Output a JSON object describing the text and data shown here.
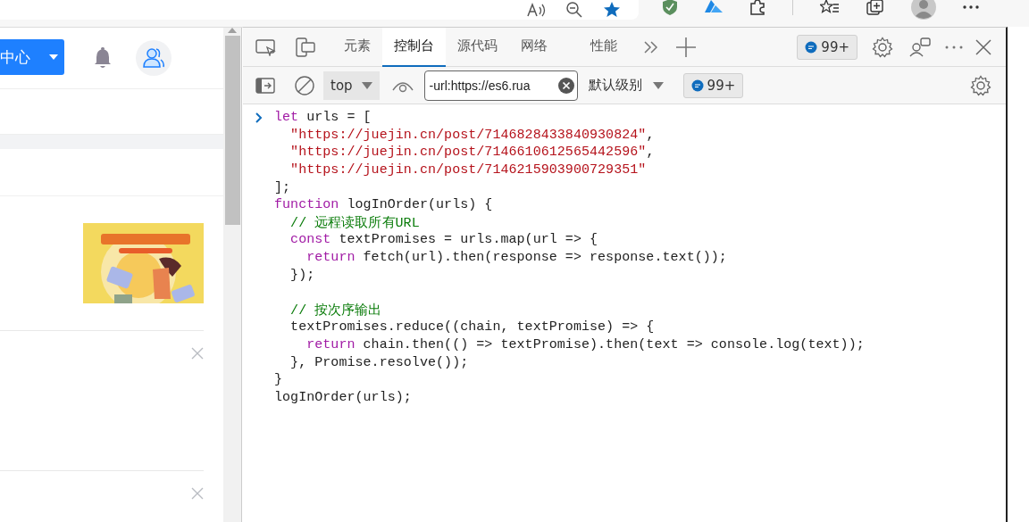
{
  "page": {
    "header_button": "中心"
  },
  "devtools": {
    "tabs": [
      {
        "label": "元素",
        "selected": false
      },
      {
        "label": "控制台",
        "selected": true
      },
      {
        "label": "源代码",
        "selected": false
      },
      {
        "label": "网络",
        "selected": false
      },
      {
        "label": "性能",
        "selected": false
      }
    ],
    "issues_badge": "99+",
    "context_select": "top",
    "filter": {
      "value": "-url:https://es6.rua"
    },
    "level_select": "默认级别",
    "filter_badge": "99+"
  },
  "console": {
    "blocks": [
      {
        "lines": [
          {
            "prompt": true,
            "segments": [
              {
                "kind": "keyword",
                "text": "let"
              },
              {
                "kind": "plain",
                "text": " urls = ["
              }
            ]
          },
          {
            "prompt": false,
            "segments": [
              {
                "kind": "string",
                "text": "  \"https://juejin.cn/post/7146828433840930824\""
              },
              {
                "kind": "plain",
                "text": ","
              }
            ]
          },
          {
            "prompt": false,
            "segments": [
              {
                "kind": "string",
                "text": "  \"https://juejin.cn/post/7146610612565442596\""
              },
              {
                "kind": "plain",
                "text": ","
              }
            ]
          },
          {
            "prompt": false,
            "segments": [
              {
                "kind": "string",
                "text": "  \"https://juejin.cn/post/7146215903900729351\""
              }
            ]
          },
          {
            "prompt": false,
            "segments": [
              {
                "kind": "plain",
                "text": "];"
              }
            ]
          },
          {
            "prompt": false,
            "segments": [
              {
                "kind": "keyword",
                "text": "function"
              },
              {
                "kind": "plain",
                "text": " logInOrder(urls) {"
              }
            ]
          },
          {
            "prompt": false,
            "segments": [
              {
                "kind": "comment",
                "text": "  // 远程读取所有URL"
              }
            ]
          },
          {
            "prompt": false,
            "segments": [
              {
                "kind": "keyword",
                "text": "  const"
              },
              {
                "kind": "plain",
                "text": " textPromises = urls.map(url => {"
              }
            ]
          },
          {
            "prompt": false,
            "segments": [
              {
                "kind": "keyword",
                "text": "    return"
              },
              {
                "kind": "plain",
                "text": " fetch(url).then(response => response.text());"
              }
            ]
          },
          {
            "prompt": false,
            "segments": [
              {
                "kind": "plain",
                "text": "  });"
              }
            ]
          }
        ]
      },
      {
        "lines": [
          {
            "prompt": false,
            "segments": [
              {
                "kind": "comment",
                "text": "  // 按次序输出"
              }
            ]
          },
          {
            "prompt": false,
            "segments": [
              {
                "kind": "plain",
                "text": "  textPromises.reduce((chain, textPromise) => {"
              }
            ]
          },
          {
            "prompt": false,
            "segments": [
              {
                "kind": "keyword",
                "text": "    return"
              },
              {
                "kind": "plain",
                "text": " chain.then(() => textPromise).then(text => console.log(text));"
              }
            ]
          },
          {
            "prompt": false,
            "segments": [
              {
                "kind": "plain",
                "text": "  }, Promise.resolve());"
              }
            ]
          },
          {
            "prompt": false,
            "segments": [
              {
                "kind": "plain",
                "text": "}"
              }
            ]
          },
          {
            "prompt": false,
            "segments": [
              {
                "kind": "plain",
                "text": "logInOrder(urls);"
              }
            ]
          }
        ]
      }
    ]
  }
}
